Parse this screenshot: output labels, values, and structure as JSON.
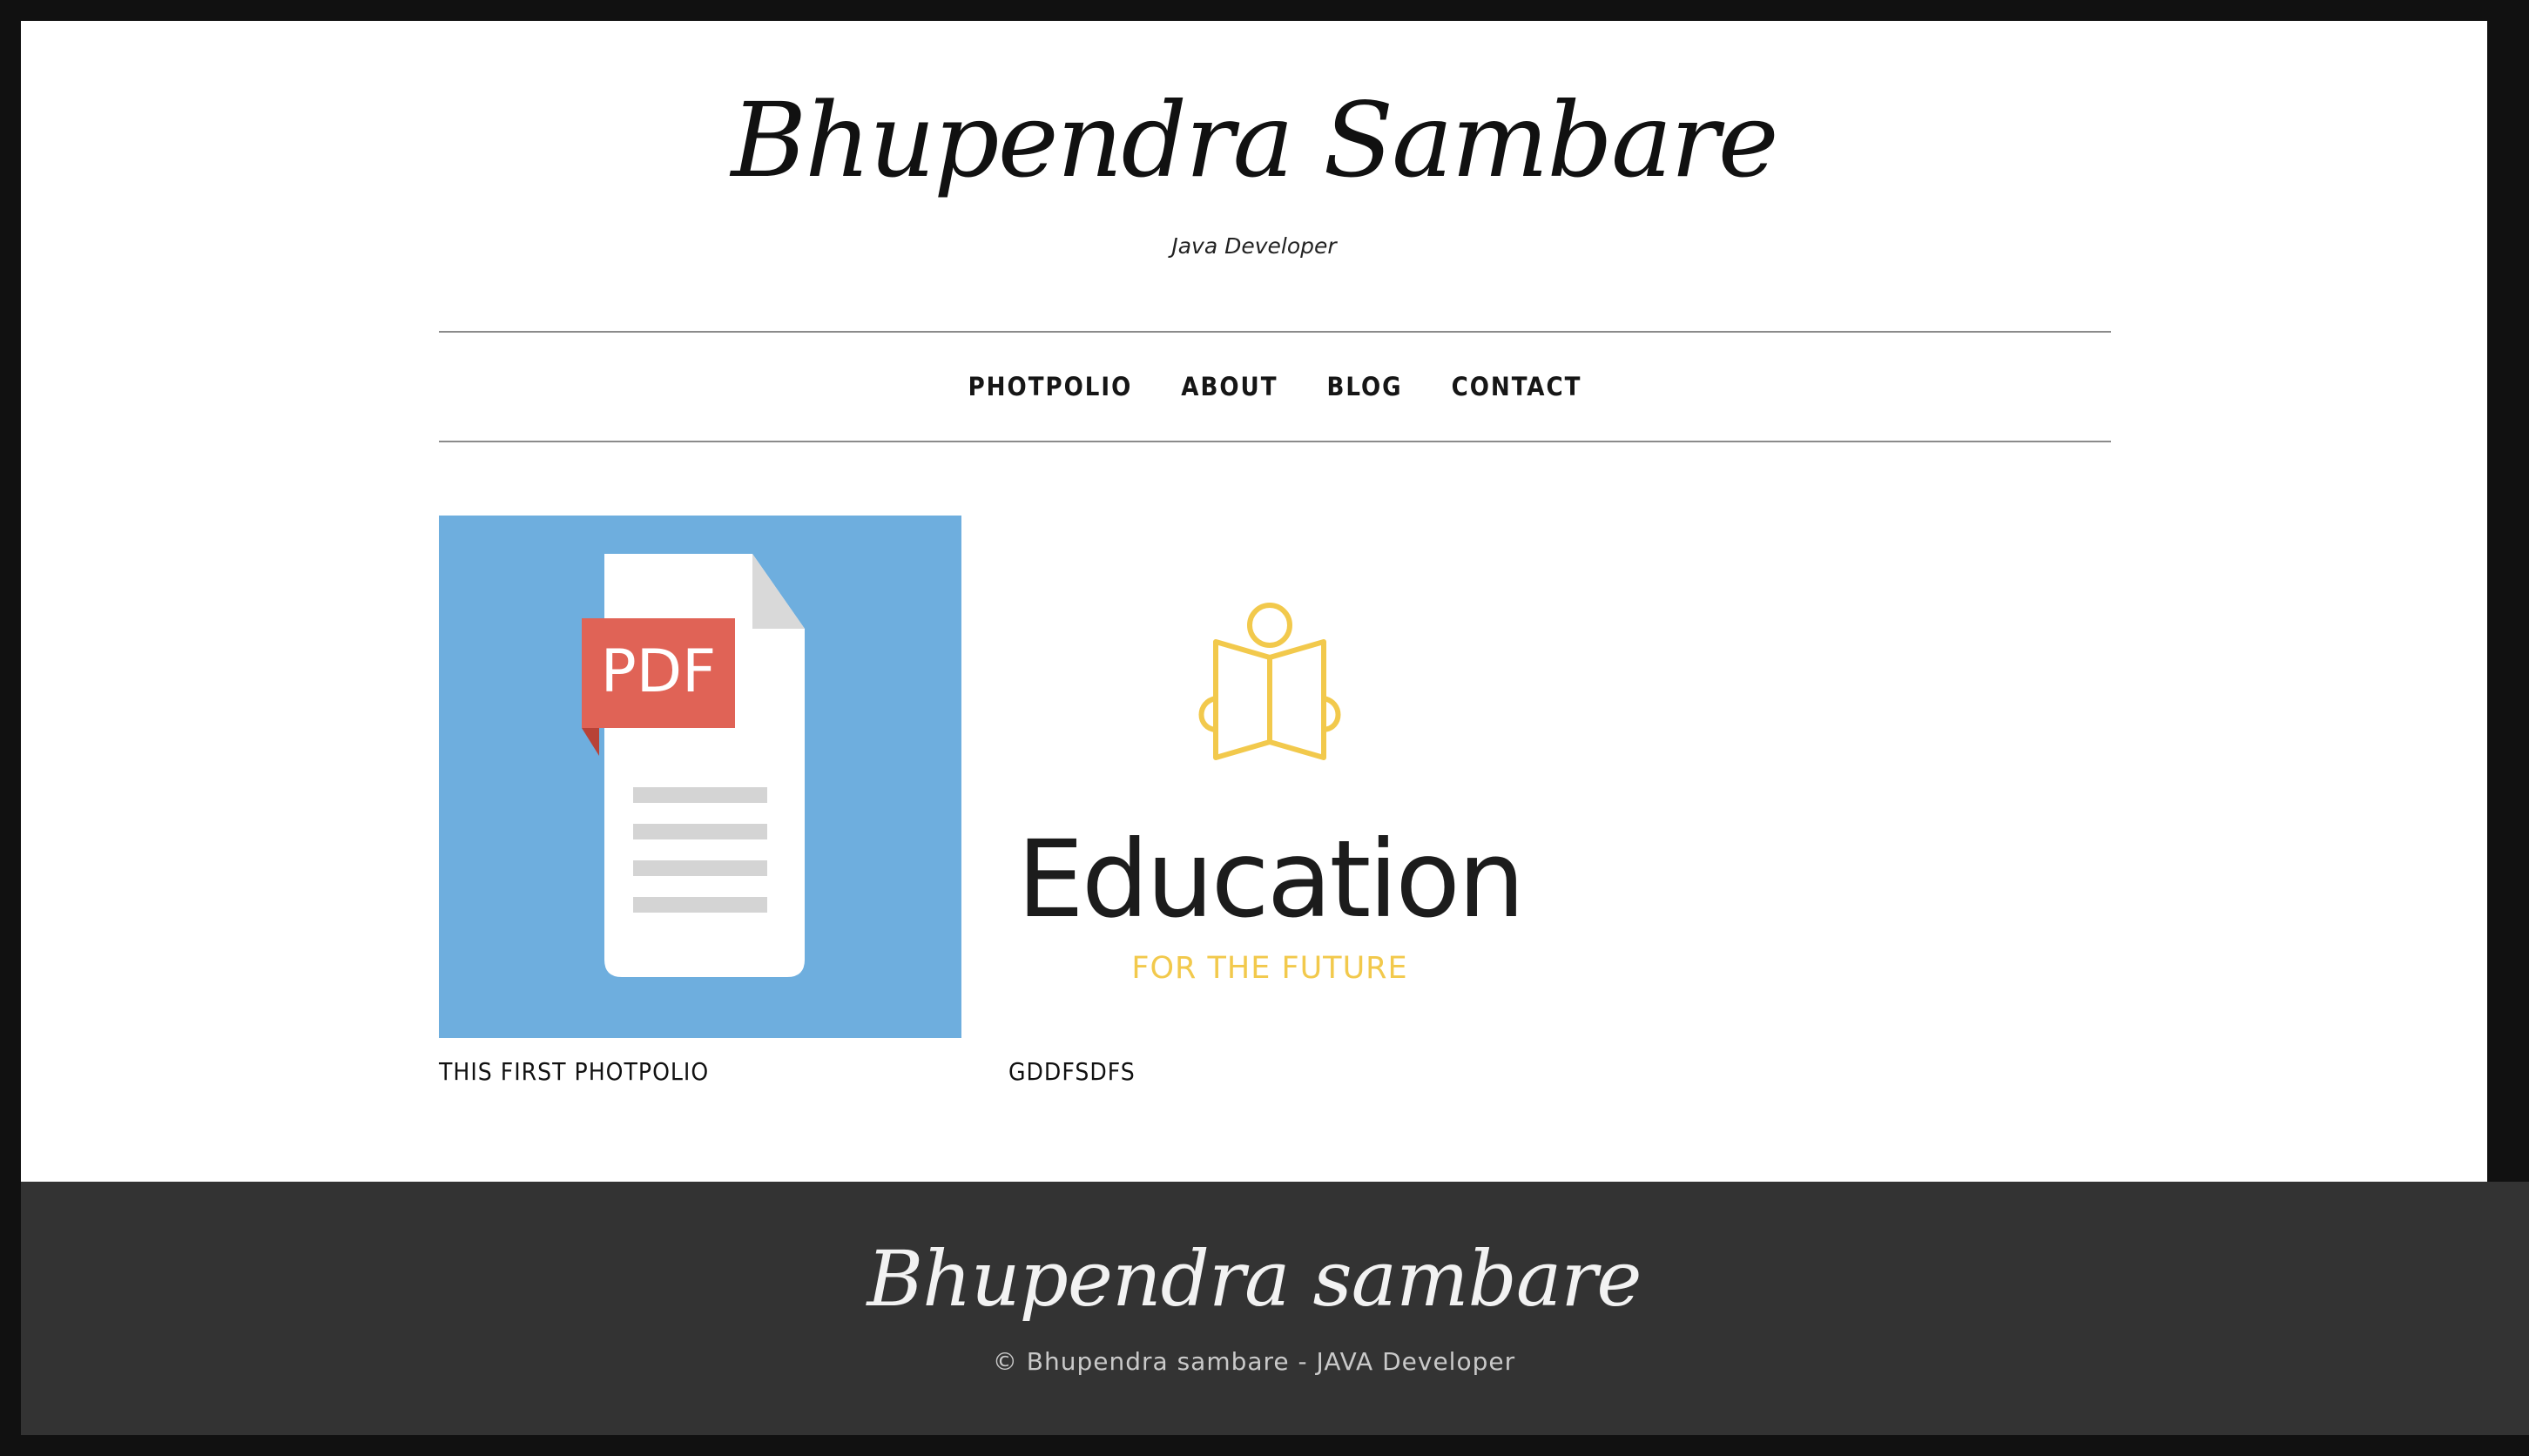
{
  "header": {
    "site_title": "Bhupendra Sambare",
    "tagline": "Java Developer"
  },
  "nav": {
    "items": [
      {
        "label": "PHOTPOLIO"
      },
      {
        "label": "ABOUT"
      },
      {
        "label": "BLOG"
      },
      {
        "label": "CONTACT"
      }
    ]
  },
  "portfolio": {
    "items": [
      {
        "title": "THIS FIRST PHOTPOLIO",
        "image": {
          "kind": "pdf-document-icon",
          "badge_text": "PDF",
          "background_color": "#6eaede",
          "badge_color": "#e06356",
          "page_color": "#ffffff"
        }
      },
      {
        "title": "GDDFSDFS",
        "image": {
          "kind": "education-logo",
          "heading": "Education",
          "subheading": "FOR THE FUTURE",
          "accent_color": "#f2c94c"
        }
      }
    ]
  },
  "footer": {
    "brand": "Bhupendra sambare",
    "copyright": "© Bhupendra sambare - JAVA Developer"
  },
  "colors": {
    "frame": "#111111",
    "footer_bg": "#333333",
    "nav_border": "#8b8b8b"
  }
}
